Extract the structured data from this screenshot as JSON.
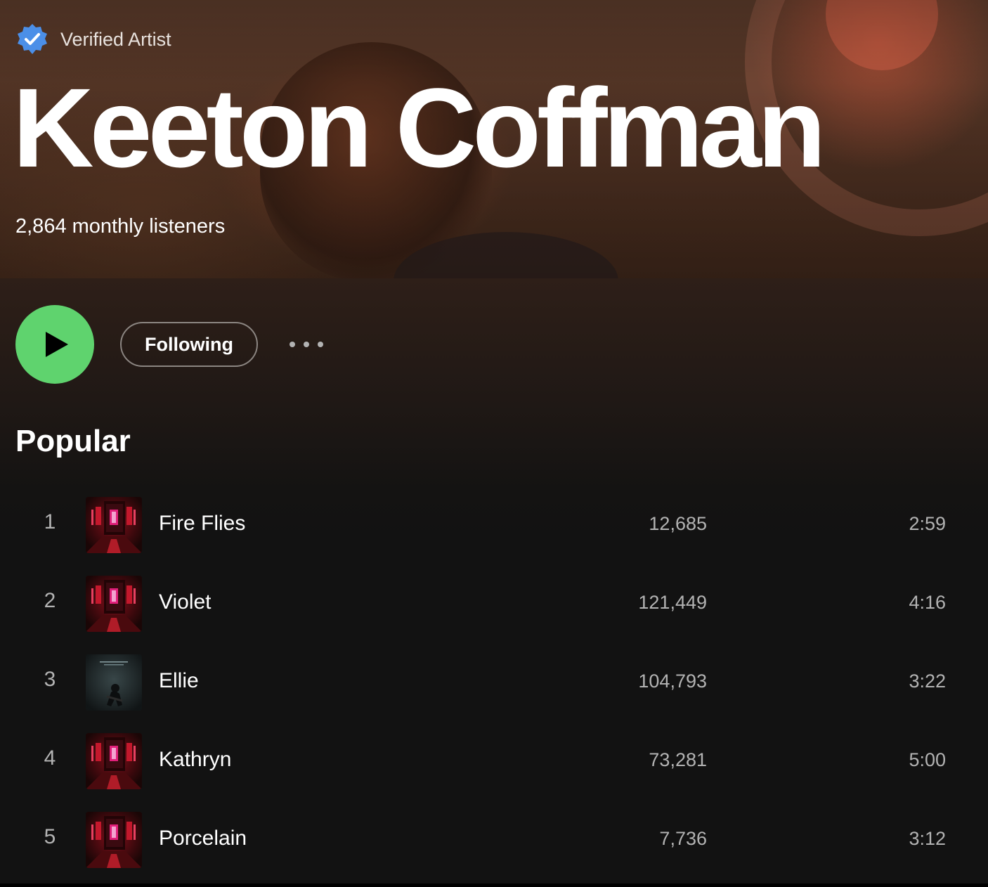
{
  "artist": {
    "verified_label": "Verified Artist",
    "name": "Keeton Coffman",
    "monthly_listeners": "2,864 monthly listeners"
  },
  "actions": {
    "follow_label": "Following",
    "play_icon": "play-icon",
    "more_icon": "ellipsis-icon"
  },
  "popular": {
    "title": "Popular",
    "tracks": [
      {
        "number": "1",
        "title": "Fire Flies",
        "plays": "12,685",
        "duration": "2:59",
        "artwork": "red-doorway-cover"
      },
      {
        "number": "2",
        "title": "Violet",
        "plays": "121,449",
        "duration": "4:16",
        "artwork": "red-doorway-cover"
      },
      {
        "number": "3",
        "title": "Ellie",
        "plays": "104,793",
        "duration": "3:22",
        "artwork": "guitarist-cover"
      },
      {
        "number": "4",
        "title": "Kathryn",
        "plays": "73,281",
        "duration": "5:00",
        "artwork": "red-doorway-cover"
      },
      {
        "number": "5",
        "title": "Porcelain",
        "plays": "7,736",
        "duration": "3:12",
        "artwork": "red-doorway-cover"
      }
    ]
  },
  "colors": {
    "accent_green": "#5fd36e",
    "verified_blue": "#4b8fe8",
    "background": "#121212",
    "secondary_text": "#b3b3b3"
  }
}
